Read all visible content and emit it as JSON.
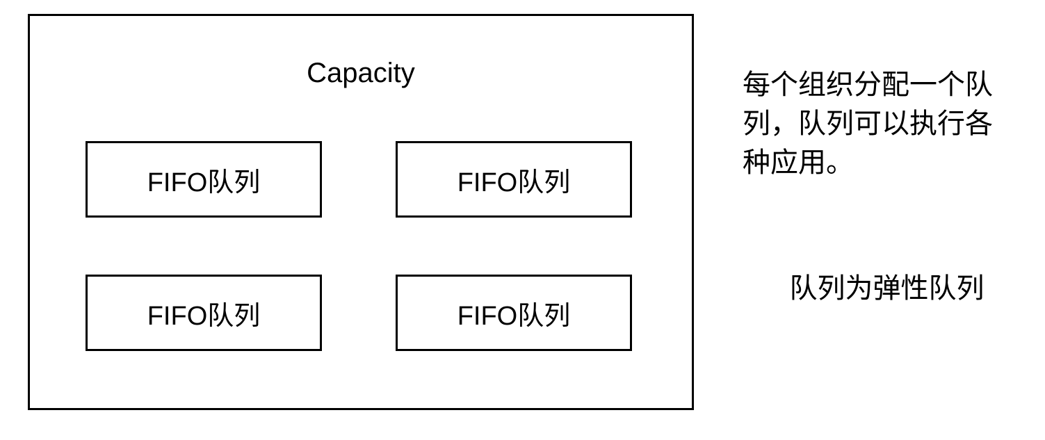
{
  "diagram": {
    "title": "Capacity",
    "queues": [
      {
        "label": "FIFO队列"
      },
      {
        "label": "FIFO队列"
      },
      {
        "label": "FIFO队列"
      },
      {
        "label": "FIFO队列"
      }
    ]
  },
  "descriptions": {
    "line1": "每个组织分配一个队列，队列可以执行各种应用。",
    "line2": "队列为弹性队列"
  }
}
